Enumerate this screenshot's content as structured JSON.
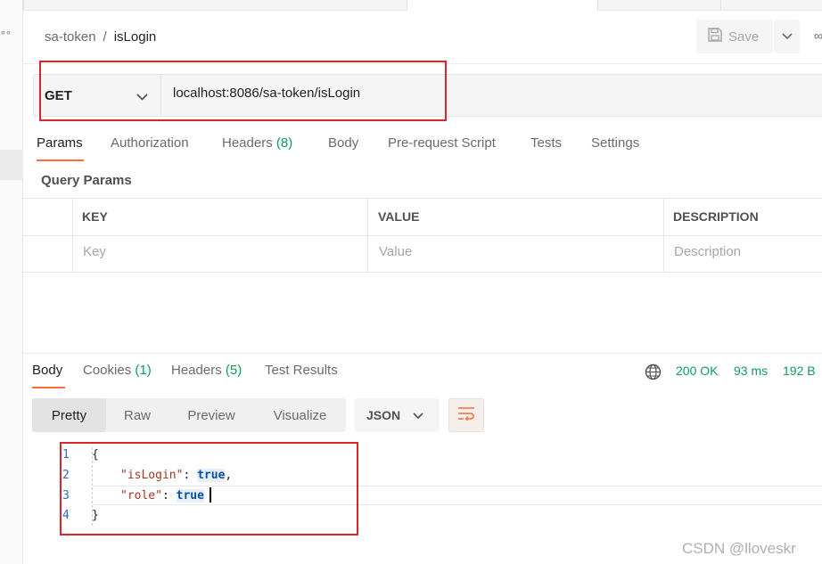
{
  "breadcrumb": {
    "parent": "sa-token",
    "separator": "/",
    "current": "isLogin"
  },
  "toolbar": {
    "save_label": "Save"
  },
  "request": {
    "method": "GET",
    "url": "localhost:8086/sa-token/isLogin",
    "tabs": [
      {
        "label": "Params"
      },
      {
        "label": "Authorization"
      },
      {
        "label": "Headers",
        "count": "(8)"
      },
      {
        "label": "Body"
      },
      {
        "label": "Pre-request Script"
      },
      {
        "label": "Tests"
      },
      {
        "label": "Settings"
      }
    ]
  },
  "query_params": {
    "title": "Query Params",
    "columns": [
      "KEY",
      "VALUE",
      "DESCRIPTION"
    ],
    "placeholders": [
      "Key",
      "Value",
      "Description"
    ]
  },
  "response": {
    "tabs": [
      {
        "label": "Body"
      },
      {
        "label": "Cookies",
        "count": "(1)"
      },
      {
        "label": "Headers",
        "count": "(5)"
      },
      {
        "label": "Test Results"
      }
    ],
    "status": "200 OK",
    "time": "93 ms",
    "size": "192 B",
    "view_modes": [
      "Pretty",
      "Raw",
      "Preview",
      "Visualize"
    ],
    "format": "JSON",
    "lines": [
      {
        "n": "1",
        "text": "{"
      },
      {
        "n": "2",
        "key": "\"isLogin\"",
        "sep": ": ",
        "val": "true",
        "tail": ","
      },
      {
        "n": "3",
        "key": "\"role\"",
        "sep": ": ",
        "val": "true",
        "tail": ""
      },
      {
        "n": "4",
        "text": "}"
      }
    ]
  },
  "watermark": "CSDN @lloveskr",
  "colors": {
    "accent": "#ff6c37",
    "success": "#0f9d58",
    "highlight_box": "#d8262c"
  }
}
